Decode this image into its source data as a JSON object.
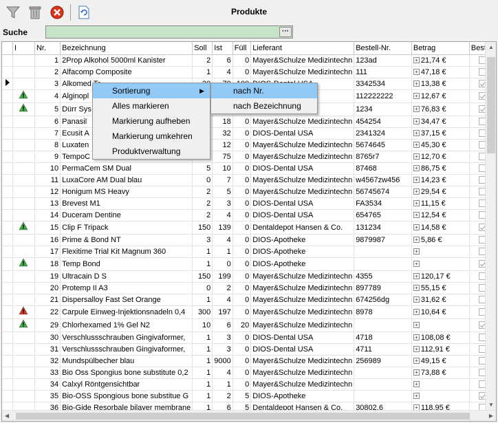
{
  "window": {
    "title": "Produkte"
  },
  "search": {
    "label": "Suche",
    "value": "",
    "button_label": "···"
  },
  "columns": [
    "I",
    "Nr.",
    "Bezeichnung",
    "Soll",
    "Ist",
    "Füll",
    "Lieferant",
    "Bestell-Nr.",
    "Betrag",
    "Bestell"
  ],
  "rows": [
    {
      "ind": "",
      "nr": "1",
      "name": "2Prop Alkohol 5000ml Kanister",
      "soll": "2",
      "ist": "6",
      "fuell": "0",
      "lief": "Mayer&Schulze Medizintechn",
      "best": "123ad",
      "betrag": "21,74 €",
      "checked": false
    },
    {
      "ind": "",
      "nr": "2",
      "name": "Alfacomp Composite",
      "soll": "1",
      "ist": "4",
      "fuell": "0",
      "lief": "Mayer&Schulze Medizintechn",
      "best": "111",
      "betrag": "47,18 €",
      "checked": false
    },
    {
      "ind": "",
      "nr": "3",
      "name": "Alkomed Tr",
      "soll": "20",
      "ist": "70",
      "fuell": "100",
      "lief": "DIOS-Dental USA",
      "best": "3342534",
      "betrag": "13,38 €",
      "checked": true
    },
    {
      "ind": "warn-green",
      "nr": "4",
      "name": "Alginopl",
      "soll": "",
      "ist": "",
      "fuell": "",
      "lief": "Co.",
      "best": "112222222",
      "betrag": "12,67 €",
      "checked": true
    },
    {
      "ind": "warn-green",
      "nr": "5",
      "name": "Dürr Sys",
      "soll": "",
      "ist": "",
      "fuell": "",
      "lief": "Co.",
      "best": "1234",
      "betrag": "76,83 €",
      "checked": true
    },
    {
      "ind": "",
      "nr": "6",
      "name": "Panasil",
      "soll": "",
      "ist": "18",
      "fuell": "0",
      "lief": "Mayer&Schulze Medizintechn",
      "best": "454254",
      "betrag": "34,47 €",
      "checked": false
    },
    {
      "ind": "",
      "nr": "7",
      "name": "Ecusit A",
      "soll": "",
      "ist": "32",
      "fuell": "0",
      "lief": "DIOS-Dental USA",
      "best": "2341324",
      "betrag": "37,15 €",
      "checked": false
    },
    {
      "ind": "",
      "nr": "8",
      "name": "Luxaten",
      "soll": "",
      "ist": "12",
      "fuell": "0",
      "lief": "Mayer&Schulze Medizintechn",
      "best": "5674645",
      "betrag": "45,30 €",
      "checked": false
    },
    {
      "ind": "",
      "nr": "9",
      "name": "TempoC",
      "soll": "",
      "ist": "75",
      "fuell": "0",
      "lief": "Mayer&Schulze Medizintechn",
      "best": "8765r7",
      "betrag": "12,70 €",
      "checked": false
    },
    {
      "ind": "",
      "nr": "10",
      "name": "PermaCem SM Dual",
      "soll": "5",
      "ist": "10",
      "fuell": "0",
      "lief": "DIOS-Dental USA",
      "best": "87468",
      "betrag": "86,75 €",
      "checked": false
    },
    {
      "ind": "",
      "nr": "11",
      "name": "LuxaCore AM Dual blau",
      "soll": "0",
      "ist": "7",
      "fuell": "0",
      "lief": "Mayer&Schulze Medizintechn",
      "best": "w4567zw456",
      "betrag": "14,23 €",
      "checked": false
    },
    {
      "ind": "",
      "nr": "12",
      "name": "Honigum MS Heavy",
      "soll": "2",
      "ist": "5",
      "fuell": "0",
      "lief": "Mayer&Schulze Medizintechn",
      "best": "56745674",
      "betrag": "29,54 €",
      "checked": false
    },
    {
      "ind": "",
      "nr": "13",
      "name": "Brevest  M1",
      "soll": "2",
      "ist": "3",
      "fuell": "0",
      "lief": "DIOS-Dental USA",
      "best": "FA3534",
      "betrag": "11,15 €",
      "checked": false
    },
    {
      "ind": "",
      "nr": "14",
      "name": "Duceram Dentine",
      "soll": "2",
      "ist": "4",
      "fuell": "0",
      "lief": "DIOS-Dental USA",
      "best": "654765",
      "betrag": "12,54 €",
      "checked": false
    },
    {
      "ind": "warn-green",
      "nr": "15",
      "name": "Clip F Tripack",
      "soll": "150",
      "ist": "139",
      "fuell": "0",
      "lief": "Dentaldepot Hansen & Co.",
      "best": "131234",
      "betrag": "14,58 €",
      "checked": true
    },
    {
      "ind": "",
      "nr": "16",
      "name": "Prime & Bond NT",
      "soll": "3",
      "ist": "4",
      "fuell": "0",
      "lief": "DIOS-Apotheke",
      "best": "9879987",
      "betrag": "5,86 €",
      "checked": false
    },
    {
      "ind": "",
      "nr": "17",
      "name": "Flexitime Trial Kit Magnum 360",
      "soll": "1",
      "ist": "1",
      "fuell": "0",
      "lief": "DIOS-Apotheke",
      "best": "",
      "betrag": "",
      "checked": false
    },
    {
      "ind": "warn-green",
      "nr": "18",
      "name": "Temp Bond",
      "soll": "1",
      "ist": "0",
      "fuell": "0",
      "lief": "DIOS-Apotheke",
      "best": "",
      "betrag": "",
      "checked": true
    },
    {
      "ind": "",
      "nr": "19",
      "name": "Ultracain D S",
      "soll": "150",
      "ist": "199",
      "fuell": "0",
      "lief": "Mayer&Schulze Medizintechn",
      "best": "4355",
      "betrag": "120,17 €",
      "checked": false
    },
    {
      "ind": "",
      "nr": "20",
      "name": "Protemp II A3",
      "soll": "0",
      "ist": "2",
      "fuell": "0",
      "lief": "Mayer&Schulze Medizintechn",
      "best": "897789",
      "betrag": "55,15 €",
      "checked": false
    },
    {
      "ind": "",
      "nr": "21",
      "name": "Dispersalloy Fast Set Orange",
      "soll": "1",
      "ist": "4",
      "fuell": "0",
      "lief": "Mayer&Schulze Medizintechn",
      "best": "674256dg",
      "betrag": "31,62 €",
      "checked": false
    },
    {
      "ind": "warn-red",
      "nr": "22",
      "name": "Carpule Einweg-Injektionsnadeln 0,4",
      "soll": "300",
      "ist": "197",
      "fuell": "0",
      "lief": "Mayer&Schulze Medizintechn",
      "best": "8978",
      "betrag": "10,64 €",
      "checked": false
    },
    {
      "ind": "warn-green",
      "nr": "29",
      "name": "Chlorhexamed 1% Gel N2",
      "soll": "10",
      "ist": "6",
      "fuell": "20",
      "lief": "Mayer&Schulze Medizintechn",
      "best": "",
      "betrag": "",
      "checked": true
    },
    {
      "ind": "",
      "nr": "30",
      "name": "Verschlussschrauben Gingivaformer,",
      "soll": "1",
      "ist": "3",
      "fuell": "0",
      "lief": "DIOS-Dental USA",
      "best": "4718",
      "betrag": "108,08 €",
      "checked": false
    },
    {
      "ind": "",
      "nr": "31",
      "name": "Verschlussschrauben Gingivaformer,",
      "soll": "1",
      "ist": "3",
      "fuell": "0",
      "lief": "DIOS-Dental USA",
      "best": "4711",
      "betrag": "112,91 €",
      "checked": false
    },
    {
      "ind": "",
      "nr": "32",
      "name": "Mundspülbecher blau",
      "soll": "1",
      "ist": "9000",
      "fuell": "0",
      "lief": "Mayer&Schulze Medizintechn",
      "best": "256989",
      "betrag": "49,15 €",
      "checked": false
    },
    {
      "ind": "",
      "nr": "33",
      "name": "Bio Oss Spongius bone substitute 0,2",
      "soll": "1",
      "ist": "4",
      "fuell": "0",
      "lief": "Mayer&Schulze Medizintechn",
      "best": "",
      "betrag": "73,88 €",
      "checked": false
    },
    {
      "ind": "",
      "nr": "34",
      "name": "Calxyl Röntgensichtbar",
      "soll": "1",
      "ist": "1",
      "fuell": "0",
      "lief": "Mayer&Schulze Medizintechn",
      "best": "",
      "betrag": "",
      "checked": false
    },
    {
      "ind": "",
      "nr": "35",
      "name": "Bio-OSS Spongious bone substitue G",
      "soll": "1",
      "ist": "2",
      "fuell": "5",
      "lief": "DIOS-Apotheke",
      "best": "",
      "betrag": "",
      "checked": true
    },
    {
      "ind": "",
      "nr": "36",
      "name": "Bio-Gide Resorbale bilayer membrane",
      "soll": "1",
      "ist": "6",
      "fuell": "5",
      "lief": "Dentaldepot Hansen & Co.",
      "best": "30802.6",
      "betrag": "118,95 €",
      "checked": false
    }
  ],
  "context_menu": {
    "items": [
      "Sortierung",
      "Alles markieren",
      "Markierung aufheben",
      "Markierung umkehren",
      "Produktverwaltung"
    ]
  },
  "submenu": {
    "items": [
      "nach Nr.",
      "nach Bezeichnung"
    ]
  },
  "icons": {
    "filter": "filter-icon",
    "delete": "trash-icon",
    "close": "close-icon",
    "refresh": "refresh-icon",
    "row_pointer": "row-pointer-icon",
    "warn_green": "warning-green-icon",
    "warn_red": "warning-red-icon"
  },
  "colors": {
    "search_bg": "#c8e4c8",
    "menu_highlight": "#91c9f7",
    "warn_green": "#3cb043",
    "warn_red": "#d9341c"
  }
}
